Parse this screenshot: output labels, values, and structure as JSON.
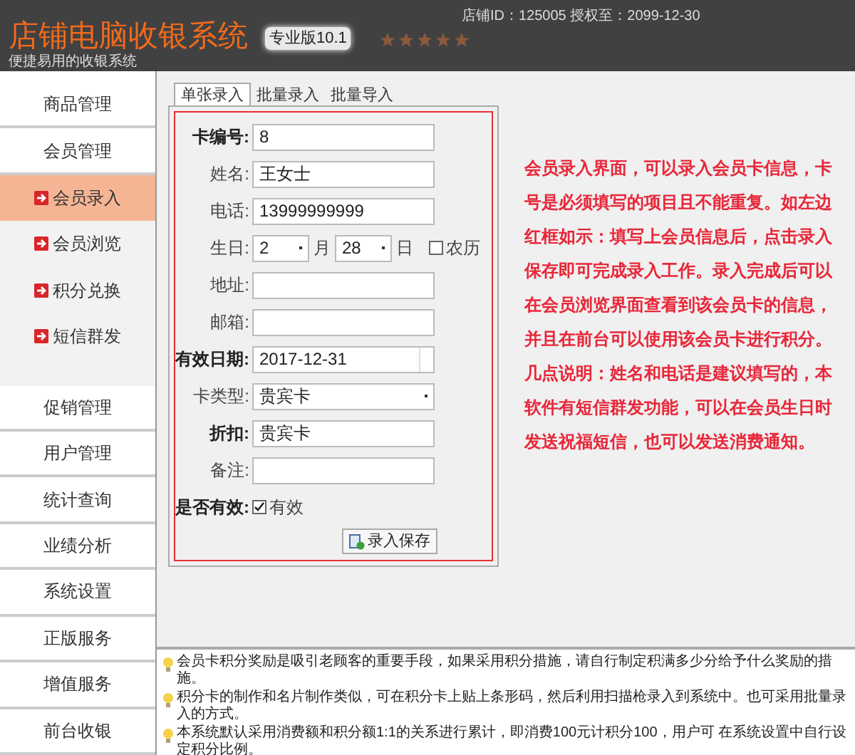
{
  "header": {
    "title": "店铺电脑收银系统",
    "edition": "专业版10.1",
    "stars": 5,
    "subtitle": "便捷易用的收银系统",
    "store_info": "店铺ID：125005 授权至：2099-12-30"
  },
  "sidebar": {
    "items": [
      {
        "label": "商品管理",
        "kind": "main",
        "selected": false
      },
      {
        "label": "会员管理",
        "kind": "main",
        "selected": false
      },
      {
        "label": "会员录入",
        "kind": "sub",
        "selected": true
      },
      {
        "label": "会员浏览",
        "kind": "sub",
        "selected": false
      },
      {
        "label": "积分兑换",
        "kind": "sub",
        "selected": false
      },
      {
        "label": "短信群发",
        "kind": "sub",
        "selected": false
      },
      {
        "label": "促销管理",
        "kind": "main",
        "selected": false
      },
      {
        "label": "用户管理",
        "kind": "main",
        "selected": false
      },
      {
        "label": "统计查询",
        "kind": "main",
        "selected": false
      },
      {
        "label": "业绩分析",
        "kind": "main",
        "selected": false
      },
      {
        "label": "系统设置",
        "kind": "main",
        "selected": false
      },
      {
        "label": "正版服务",
        "kind": "main",
        "selected": false
      },
      {
        "label": "增值服务",
        "kind": "main",
        "selected": false
      },
      {
        "label": "前台收银",
        "kind": "main",
        "selected": false
      }
    ]
  },
  "tabs": [
    {
      "label": "单张录入",
      "selected": true
    },
    {
      "label": "批量录入",
      "selected": false
    },
    {
      "label": "批量导入",
      "selected": false
    }
  ],
  "form": {
    "fields": [
      {
        "kind": "text",
        "label": "卡编号:",
        "value": "8",
        "bold": true
      },
      {
        "kind": "text",
        "label": "姓名:",
        "value": "王女士",
        "bold": false
      },
      {
        "kind": "text",
        "label": "电话:",
        "value": "13999999999",
        "bold": false
      },
      {
        "kind": "birthday",
        "label": "生日:",
        "month": "2",
        "month_unit": "月",
        "day": "28",
        "day_unit": "日",
        "lunar_label": "农历",
        "lunar": false
      },
      {
        "kind": "text",
        "label": "地址:",
        "bold": false
      },
      {
        "kind": "text",
        "label": "邮箱:",
        "bold": false
      },
      {
        "kind": "date",
        "label": "有效日期:",
        "value": "2017-12-31",
        "bold": true
      },
      {
        "kind": "select",
        "label": "卡类型:",
        "value": "贵宾卡",
        "bold": false
      },
      {
        "kind": "text",
        "label": "折扣:",
        "value": "贵宾卡",
        "bold": true
      },
      {
        "kind": "text",
        "label": "备注:",
        "bold": false
      },
      {
        "kind": "checkbox",
        "label": "是否有效:",
        "option": "有效",
        "checked": true
      }
    ],
    "save_button": "录入保存"
  },
  "note": "会员录入界面，可以录入会员卡信息，卡号是必须填写的项目且不能重复。如左边红框如示：填写上会员信息后，点击录入保存即可完成录入工作。录入完成后可以在会员浏览界面查看到该会员卡的信息，并且在前台可以使用该会员卡进行积分。几点说明：姓名和电话是建议填写的，本软件有短信群发功能，可以在会员生日时发送祝福短信，也可以发送消费通知。",
  "tips": [
    "会员卡积分奖励是吸引老顾客的重要手段，如果采用积分措施，请自行制定积满多少分给予什么奖励的措施。",
    "积分卡的制作和名片制作类似，可在积分卡上贴上条形码，然后利用扫描枪录入到系统中。也可采用批量录入的方式。",
    "本系统默认采用消费额和积分额1:1的关系进行累计，即消费100元计积分100，用户可 在系统设置中自行设定积分比例。"
  ]
}
